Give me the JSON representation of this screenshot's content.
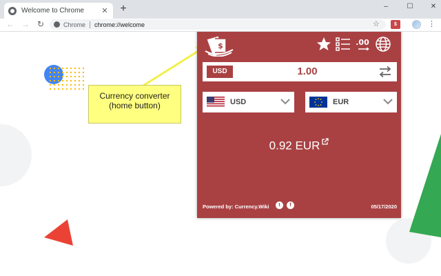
{
  "browser": {
    "tab_title": "Welcome to Chrome",
    "tab_close": "✕",
    "new_tab": "+",
    "window_controls": {
      "minimize": "–",
      "maximize": "☐",
      "close": "✕"
    },
    "back": "←",
    "forward": "→",
    "reload": "↻",
    "chip_label": "Chrome",
    "url": "chrome://welcome",
    "star": "☆",
    "extension_badge": "$",
    "menu": "⋮"
  },
  "annotation": {
    "line1": "Currency converter",
    "line2": "(home button)",
    "color": "#ffff80"
  },
  "converter": {
    "accent": "#a94143",
    "icons": [
      "money-logo-icon",
      "star-icon",
      "list-icon",
      "decimals-icon",
      "globe-icon",
      "swap-icon",
      "external-link-icon",
      "twitter-icon",
      "facebook-icon"
    ],
    "decimals_label": ".00",
    "amount_currency": "USD",
    "amount_value": "1.00",
    "from_currency": "USD",
    "to_currency": "EUR",
    "result": "0.92 EUR",
    "powered_by": "Powered by: Currency.Wiki",
    "date": "05/17/2020"
  }
}
